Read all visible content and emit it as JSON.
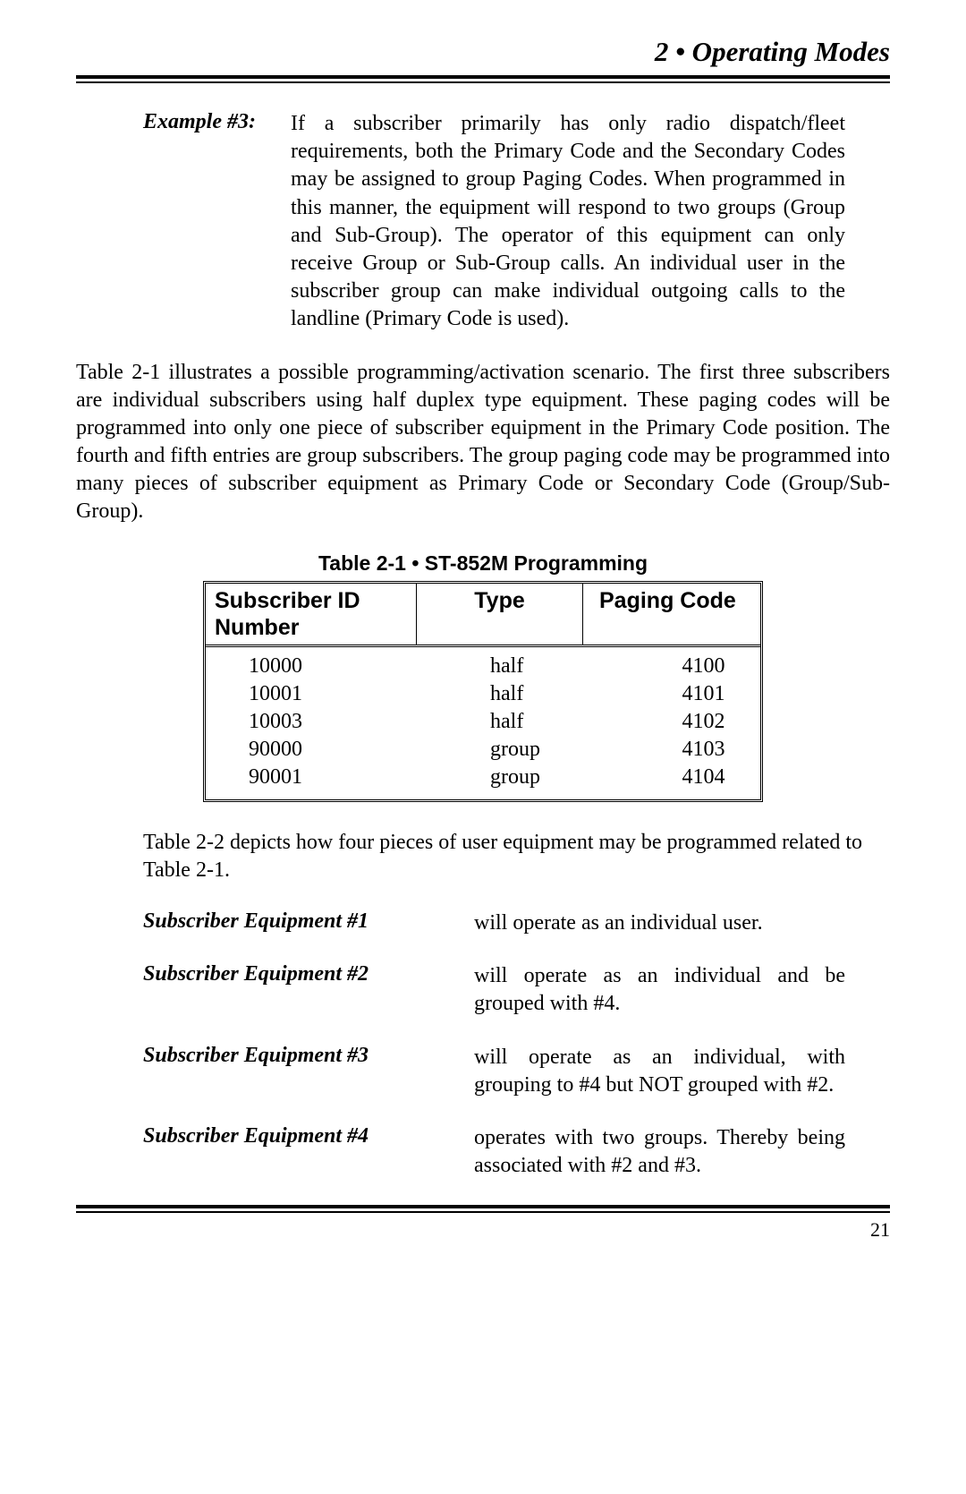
{
  "header": {
    "title": "2 • Operating Modes"
  },
  "example": {
    "label": "Example #3:",
    "text": "If a subscriber primarily has only radio dispatch/fleet requirements, both the Primary Code and the Secondary Codes may be assigned to group Paging Codes. When programmed in this manner, the equipment will respond to two groups (Group and Sub-Group).  The operator of this equipment can only receive Group or Sub-Group calls.  An individual user in the subscriber group can make individual outgoing calls to the landline (Primary Code is used)."
  },
  "para1": "Table 2-1 illustrates a possible programming/activation scenario.  The first three subscribers are individual subscribers using half duplex type equipment.  These paging codes will be programmed into only one piece of subscriber equipment in the Primary Code position.  The fourth and fifth entries are group subscribers.  The group paging code may be programmed into many pieces of subscriber equipment as Primary Code or Secondary Code (Group/Sub-Group).",
  "table": {
    "caption": "Table 2-1 • ST-852M Programming",
    "headers": {
      "col1": "Subscriber ID Number",
      "col2": "Type",
      "col3": "Paging Code"
    },
    "rows": [
      {
        "id": "10000",
        "type": "half",
        "code": "4100"
      },
      {
        "id": "10001",
        "type": "half",
        "code": "4101"
      },
      {
        "id": "10003",
        "type": "half",
        "code": "4102"
      },
      {
        "id": "90000",
        "type": "group",
        "code": "4103"
      },
      {
        "id": "90001",
        "type": "group",
        "code": "4104"
      }
    ]
  },
  "para2": "Table 2-2 depicts how four pieces of user equipment may be programmed related to Table 2-1.",
  "equipment": [
    {
      "label": "Subscriber Equipment #1",
      "text": "will operate as an individual user."
    },
    {
      "label": "Subscriber Equipment #2",
      "text": "will operate as an individual and be grouped with #4."
    },
    {
      "label": "Subscriber Equipment #3",
      "text": "will operate as an individual, with grouping to #4 but NOT grouped with #2."
    },
    {
      "label": "Subscriber Equipment #4",
      "text": "operates with two groups.  Thereby being associated with #2 and #3."
    }
  ],
  "page_number": "21"
}
